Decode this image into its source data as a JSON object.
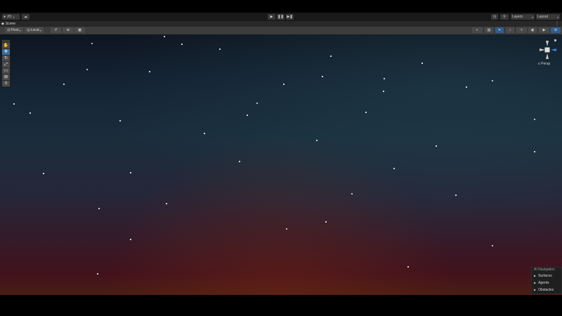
{
  "toolbar": {
    "account_label": "JO",
    "layers_label": "Layers",
    "layout_label": "Layout",
    "icons": {
      "account": "person-circle-icon",
      "cloud": "cloud-icon",
      "play": "play-icon",
      "pause": "pause-icon",
      "step": "step-icon",
      "history": "history-icon",
      "search": "search-icon"
    }
  },
  "scene_tab": {
    "label": "Scene"
  },
  "scene_toolbar": {
    "pivot_label": "Pivot",
    "local_label": "Local"
  },
  "gizmo": {
    "projection_label": "Persp"
  },
  "ai_navigation": {
    "title": "AI Navigation",
    "items": [
      {
        "label": "Surfaces"
      },
      {
        "label": "Agents"
      },
      {
        "label": "Obstacles"
      }
    ]
  },
  "colors": {
    "accent": "#3c6e9f",
    "toolbar_bg": "#191919",
    "scene_toolbar_bg": "#3c3c3c"
  }
}
